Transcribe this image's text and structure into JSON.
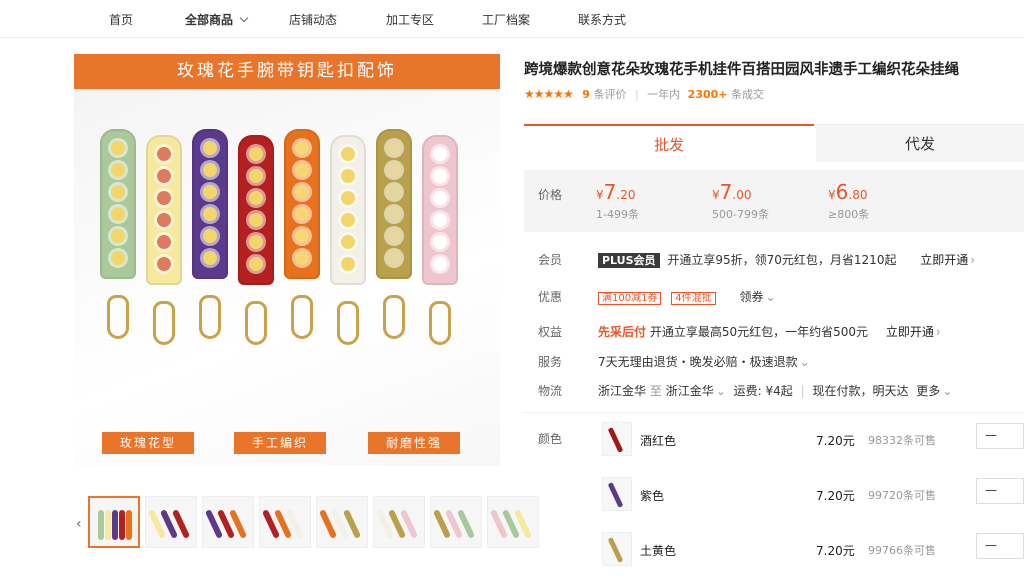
{
  "nav": {
    "items": [
      "首页",
      "全部商品",
      "店铺动态",
      "加工专区",
      "工厂档案",
      "联系方式"
    ]
  },
  "gallery": {
    "banner": "玫瑰花手腕带钥匙扣配饰",
    "tags": [
      "玫瑰花型",
      "手工编织",
      "耐磨性强"
    ],
    "strap_colors": [
      "#a9c99a",
      "#f5e9a0",
      "#5b3a8c",
      "#b3201f",
      "#e8711e",
      "#f3f0e8",
      "#b9a04a",
      "#efc6cf"
    ],
    "dot_colors": [
      "#f3d66a",
      "#e07a5f",
      "#f3d66a",
      "#f3d66a",
      "#f7d774",
      "#f3d66a",
      "#e6d7a0",
      "#ffffff"
    ],
    "thumb_count": 8,
    "prev_icon": "chevron-left-icon",
    "next_icon": "chevron-right-icon"
  },
  "product": {
    "title": "跨境爆款创意花朵玫瑰花手机挂件百搭田园风非遗手工编织花朵挂绳",
    "stars": "★★★★★",
    "review_count": "9",
    "review_label": "条评价",
    "period_label": "一年内",
    "sales_count": "2300+",
    "sales_label": "条成交"
  },
  "tabs": {
    "wholesale": "批发",
    "dropship": "代发"
  },
  "price": {
    "label": "价格",
    "tiers": [
      {
        "symbol": "¥",
        "int": "7",
        "dec": ".20",
        "range": "1-499条"
      },
      {
        "symbol": "¥",
        "int": "7",
        "dec": ".00",
        "range": "500-799条"
      },
      {
        "symbol": "¥",
        "int": "6",
        "dec": ".80",
        "range": "≥800条"
      }
    ]
  },
  "member": {
    "label": "会员",
    "badge": "PLUS会员",
    "text": "开通立享95折，领70元红包，月省1210起",
    "action": "立即开通"
  },
  "discount": {
    "label": "优惠",
    "coupon1": "满100减1券",
    "coupon2": "4件混批",
    "action": "领券"
  },
  "rights": {
    "label": "权益",
    "highlight": "先采后付",
    "text": "开通立享最高50元红包，一年约省500元",
    "action": "立即开通"
  },
  "service": {
    "label": "服务",
    "text": "7天无理由退货・晚发必赔・极速退款"
  },
  "logistics": {
    "label": "物流",
    "from": "浙江金华",
    "to_label": "至",
    "to": "浙江金华",
    "fee": "运费: ¥4起",
    "delivery": "现在付款，明天达",
    "more": "更多"
  },
  "colors": {
    "label": "颜色",
    "items": [
      {
        "name": "酒红色",
        "price": "7.20元",
        "stock": "98332条可售",
        "qty": "—",
        "hex": "#9e1b1b"
      },
      {
        "name": "紫色",
        "price": "7.20元",
        "stock": "99720条可售",
        "qty": "—",
        "hex": "#5b3a8c"
      },
      {
        "name": "土黄色",
        "price": "7.20元",
        "stock": "99766条可售",
        "qty": "—",
        "hex": "#b9a04a"
      }
    ]
  }
}
